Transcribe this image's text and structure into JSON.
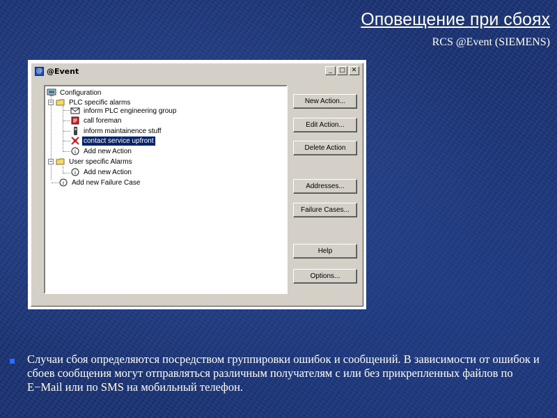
{
  "slide": {
    "title": "Оповещение при сбоях",
    "subtitle": "RCS @Event (SIEMENS)",
    "bullet_text": "Случаи сбоя определяются посредством группировки ошибок и сообщений. В зависимости от ошибок и сбоев сообщения могут отправляться различным получателям с или без прикрепленных файлов по E−Mail или по SMS на мобильный телефон."
  },
  "window": {
    "title": "@Event",
    "controls": [
      "_",
      "□",
      "✕"
    ]
  },
  "tree": {
    "root": "Configuration",
    "groups": [
      {
        "label": "PLC specific alarms",
        "children": [
          {
            "label": "inform PLC engineering group",
            "icon": "envelope-icon"
          },
          {
            "label": "call foreman",
            "icon": "sms-icon"
          },
          {
            "label": "inform maintainence stuff",
            "icon": "phone-icon"
          },
          {
            "label": "contact service upfront",
            "icon": "alarm-icon",
            "selected": true
          },
          {
            "label": "Add new Action",
            "icon": "info-icon"
          }
        ]
      },
      {
        "label": "User specific Alarms",
        "children": [
          {
            "label": "Add new Action",
            "icon": "info-icon"
          }
        ]
      }
    ],
    "add_failure": "Add new Failure Case"
  },
  "buttons": {
    "new_action": "New Action...",
    "edit_action": "Edit Action...",
    "delete_action": "Delete Action",
    "addresses": "Addresses...",
    "failure_cases": "Failure Cases...",
    "help": "Help",
    "options": "Options..."
  },
  "colors": {
    "background": "#1c3577",
    "selection": "#0a246a",
    "bullet": "#2b6cff"
  }
}
